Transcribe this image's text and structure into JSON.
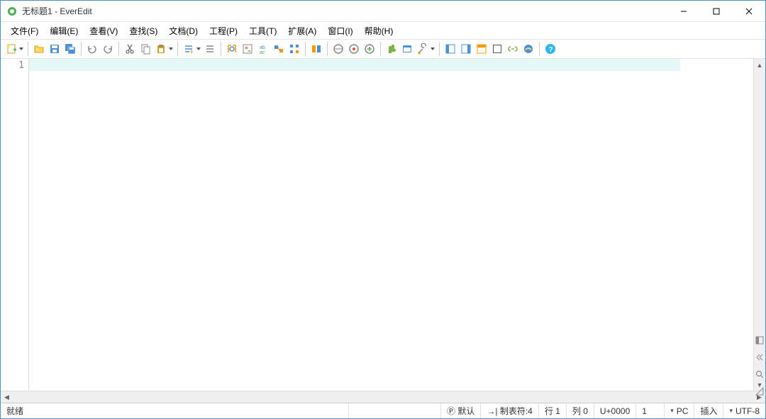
{
  "title": "无标题1 - EverEdit",
  "menus": [
    "文件(F)",
    "编辑(E)",
    "查看(V)",
    "查找(S)",
    "文档(D)",
    "工程(P)",
    "工具(T)",
    "扩展(A)",
    "窗口(I)",
    "帮助(H)"
  ],
  "toolbar_icons": {
    "new": "new-file-icon",
    "open": "open-folder-icon",
    "save": "save-icon",
    "save_all": "save-all-icon",
    "undo": "undo-icon",
    "redo": "redo-icon",
    "cut": "cut-icon",
    "copy": "copy-icon",
    "paste": "paste-icon",
    "format": "format-icon",
    "paragraph": "paragraph-icon",
    "find": "find-icon",
    "replace": "replace-icon",
    "highlight": "highlight-icon",
    "nav_back": "nav-back-icon",
    "nav_fwd": "nav-fwd-icon",
    "bookmark": "bookmark-icon",
    "browser1": "browser-icon",
    "browser2": "browser-icon",
    "browser3": "browser-icon",
    "plugin": "plugin-icon",
    "window": "window-icon",
    "tools": "tools-icon",
    "panel1": "panel-icon",
    "panel2": "panel-icon",
    "panel3": "panel-icon",
    "panel4": "panel-icon",
    "link": "link-icon",
    "ie": "ie-icon",
    "help": "help-icon"
  },
  "gutter": {
    "line1": "1"
  },
  "status": {
    "ready": "就绪",
    "parse_icon": "Ⓟ",
    "parse": "默认",
    "tab_icon": "→|",
    "tab": "制表符:4",
    "line": "行 1",
    "col": "列 0",
    "unicode": "U+0000",
    "count": "1",
    "eol": "PC",
    "mode": "插入",
    "encoding": "UTF-8"
  }
}
